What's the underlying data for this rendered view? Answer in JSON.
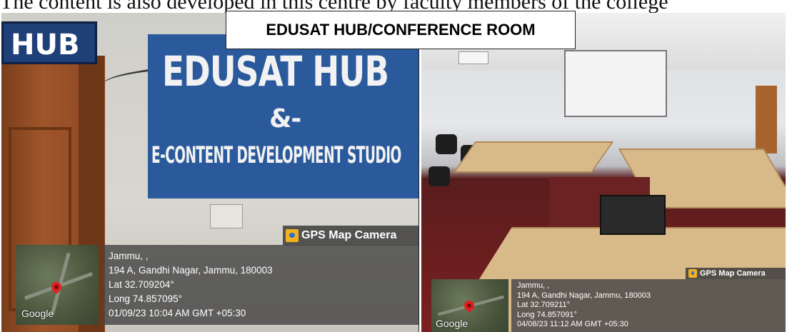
{
  "document_text": "The content is also developed in this centre by faculty members of the college",
  "headline": "EDUSAT HUB/CONFERENCE  ROOM",
  "left_photo": {
    "hub_sign": "HUB",
    "mural": {
      "line1": "EDUSAT HUB",
      "line2": "&-",
      "line3": "E-CONTENT DEVELOPMENT STUDIO"
    },
    "gps_badge": "GPS Map Camera",
    "google_label": "Google",
    "info": {
      "city": "Jammu, ,",
      "address": "194 A, Gandhi Nagar, Jammu, 180003",
      "lat": "Lat 32.709204°",
      "long": "Long 74.857095°",
      "datetime": "01/09/23 10:04 AM GMT +05:30"
    }
  },
  "right_photo": {
    "gps_badge": "GPS Map Camera",
    "google_label": "Google",
    "info": {
      "city": "Jammu, ,",
      "address": "194 A, Gandhi Nagar, Jammu, 180003",
      "lat": "Lat 32.709211°",
      "long": "Long 74.857091°",
      "datetime": "04/08/23 11:12 AM GMT +05:30"
    }
  },
  "colors": {
    "gps_badge_icon": "#f2b21f",
    "map_pin": "#e02020",
    "mural_blue": "#2a5a9c"
  }
}
